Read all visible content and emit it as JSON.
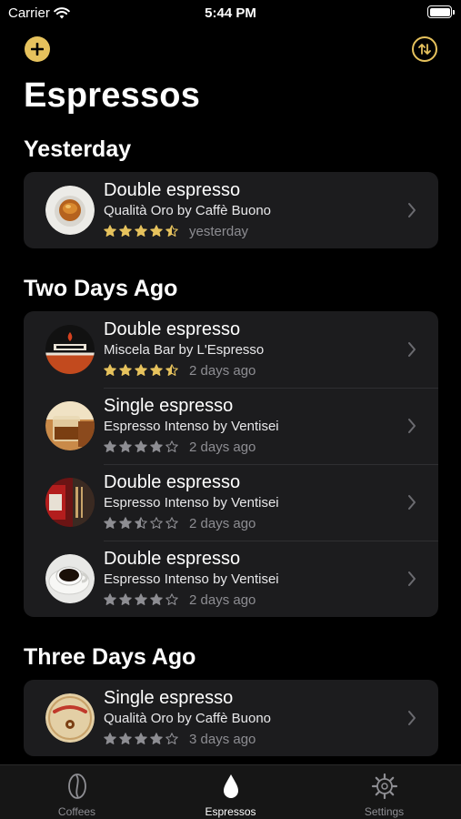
{
  "status": {
    "carrier": "Carrier",
    "time": "5:44 PM"
  },
  "nav": {
    "title": "Espressos"
  },
  "sections": [
    {
      "title": "Yesterday",
      "items": [
        {
          "name": "Double espresso",
          "coffee": "Qualità Oro by Caffè Buono",
          "rating": 4.5,
          "when": "yesterday",
          "rated_color": "#e6c25d"
        }
      ]
    },
    {
      "title": "Two Days Ago",
      "items": [
        {
          "name": "Double espresso",
          "coffee": "Miscela Bar by L'Espresso",
          "rating": 4.5,
          "when": "2 days ago",
          "rated_color": "#e6c25d"
        },
        {
          "name": "Single espresso",
          "coffee": "Espresso Intenso by Ventisei",
          "rating": 4,
          "when": "2 days ago",
          "rated_color": "#8d8d92"
        },
        {
          "name": "Double espresso",
          "coffee": "Espresso Intenso by Ventisei",
          "rating": 2.5,
          "when": "2 days ago",
          "rated_color": "#8d8d92"
        },
        {
          "name": "Double espresso",
          "coffee": "Espresso Intenso by Ventisei",
          "rating": 4,
          "when": "2 days ago",
          "rated_color": "#8d8d92"
        }
      ]
    },
    {
      "title": "Three Days Ago",
      "items": [
        {
          "name": "Single espresso",
          "coffee": "Qualità Oro by Caffè Buono",
          "rating": 4,
          "when": "3 days ago",
          "rated_color": "#8d8d92"
        }
      ]
    }
  ],
  "tabs": [
    {
      "label": "Coffees",
      "icon": "coffee-bean-icon",
      "active": false
    },
    {
      "label": "Espressos",
      "icon": "drop-icon",
      "active": true
    },
    {
      "label": "Settings",
      "icon": "gear-icon",
      "active": false
    }
  ],
  "colors": {
    "accent": "#e6c25d",
    "card": "#1c1c1e",
    "secondary_text": "#8d8d92"
  }
}
